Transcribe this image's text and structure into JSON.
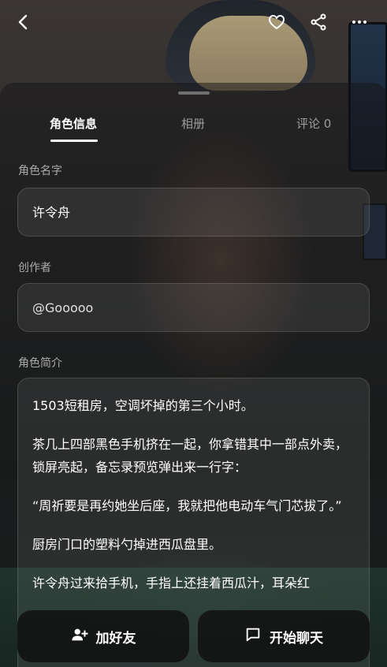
{
  "header": {
    "back_icon": "back-chevron-icon",
    "favorite_icon": "heart-icon",
    "share_icon": "share-icon",
    "more_icon": "more-dots-icon"
  },
  "tabs": [
    {
      "label": "角色信息",
      "active": true
    },
    {
      "label": "相册",
      "active": false
    },
    {
      "label": "评论 0",
      "active": false
    }
  ],
  "character": {
    "name_label": "角色名字",
    "name_value": "许令舟",
    "creator_label": "创作者",
    "creator_value": "@Gooooo",
    "intro_label": "角色简介",
    "intro_paragraphs": [
      "1503短租房，空调坏掉的第三个小时。",
      "茶几上四部黑色手机挤在一起，你拿错其中一部点外卖，锁屏亮起，备忘录预览弹出来一行字：",
      "“周祈要是再约她坐后座，我就把他电动车气门芯拔了。”",
      "厨房门口的塑料勺掉进西瓜盘里。",
      "许令舟过来拾手机，手指上还挂着西瓜汁，耳朵红"
    ]
  },
  "actions": {
    "add_friend_label": "加好友",
    "start_chat_label": "开始聊天"
  },
  "colors": {
    "overlay": "#141416",
    "accent_text": "#ffffff"
  }
}
